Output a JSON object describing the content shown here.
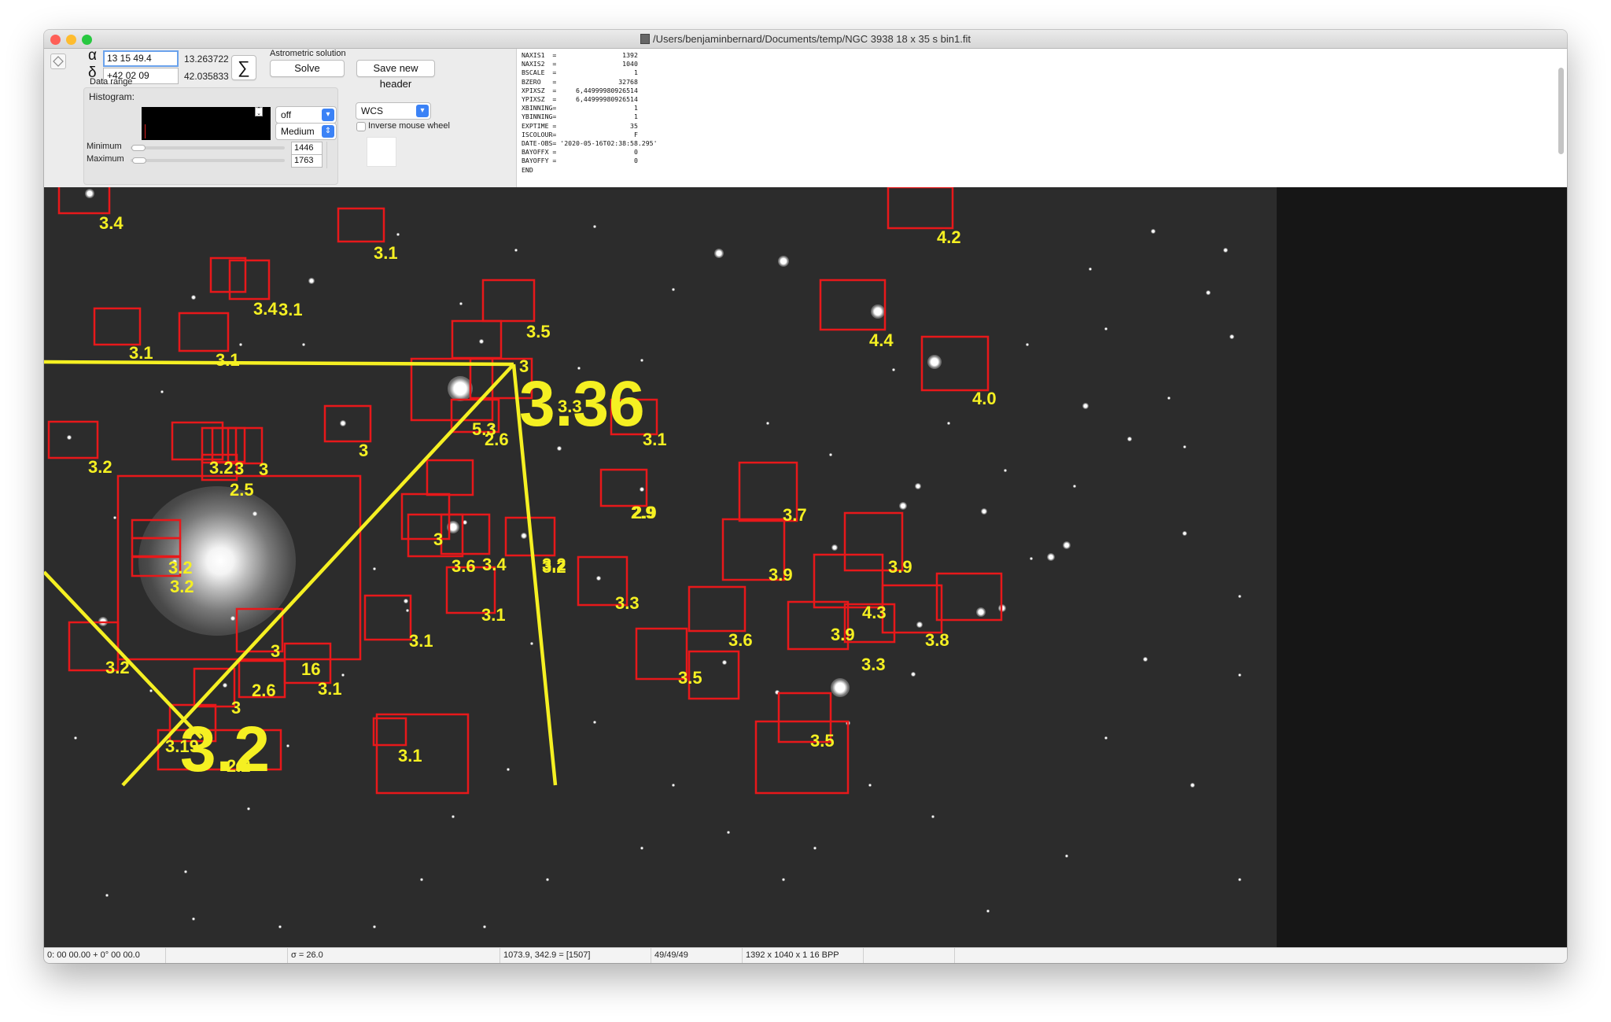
{
  "window": {
    "title": "/Users/benjaminbernard/Documents/temp/NGC 3938 18 x 35 s bin1.fit",
    "traffic_colors": {
      "close": "#ff5f57",
      "minimize": "#febc2e",
      "zoom": "#28c840"
    }
  },
  "coords": {
    "alpha_symbol": "α",
    "delta_symbol": "δ",
    "ra_input": "13 15  49.4",
    "ra_decimal": "13.263722",
    "dec_input": "+42 02  09",
    "dec_decimal": "42.035833",
    "sigma_symbol": "∑"
  },
  "astrometry": {
    "heading": "Astrometric solution",
    "solve_label": "Solve",
    "save_header_label": "Save new header"
  },
  "data_range": {
    "heading": "Data range",
    "histogram_label": "Histogram:",
    "minimum_label": "Minimum",
    "maximum_label": "Maximum",
    "minimum_value": "1446",
    "maximum_value": "1763",
    "scale_select": "off",
    "quality_select": "Medium",
    "projection_select": "WCS",
    "inverse_wheel_label": "Inverse mouse wheel"
  },
  "fits_header": [
    "NAXIS1  =                 1392",
    "NAXIS2  =                 1040",
    "BSCALE  =                    1",
    "BZERO   =                32768",
    "XPIXSZ  =     6,44999980926514",
    "YPIXSZ  =     6,44999980926514",
    "XBINNING=                    1",
    "YBINNING=                    1",
    "EXPTIME =                   35",
    "ISCOLOUR=                    F",
    "DATE-OBS= '2020-05-16T02:38:58.295'",
    "BAYOFFX =                    0",
    "BAYOFFY =                    0",
    "END"
  ],
  "overlay": {
    "hfd_labels": [
      "3.4",
      "3.1",
      "3.4",
      "3.1",
      "3.1",
      "3.1",
      "4.2",
      "3.5",
      "4.4",
      "3",
      "4.0",
      "3.36",
      "3.3",
      "3.1",
      "5.3",
      "2.6",
      "3.2",
      "3.2",
      "3",
      "3",
      "2.5",
      "3",
      "2.9",
      "3.7",
      "3.9",
      "3",
      "3.6",
      "3.4",
      "3.2",
      "3.9",
      "3.2",
      "3.2",
      "3.1",
      "3.3",
      "4.3",
      "3.9",
      "3.8",
      "3.1",
      "3.6",
      "3.3",
      "3.2",
      "3",
      "16",
      "3.1",
      "3.5",
      "2.9",
      "3.2",
      "2.6",
      "3.5",
      "3",
      "3.19",
      "3.2",
      "2.2",
      "3.1"
    ]
  },
  "status": {
    "coords": "0: 00  00.00   + 0° 00  00.0",
    "sigma": "σ = 26.0",
    "cursor": "1073.9, 342.9 = [1507]",
    "frames": "49/49/49",
    "dimensions": "1392 x 1040 x 1   16 BPP"
  }
}
